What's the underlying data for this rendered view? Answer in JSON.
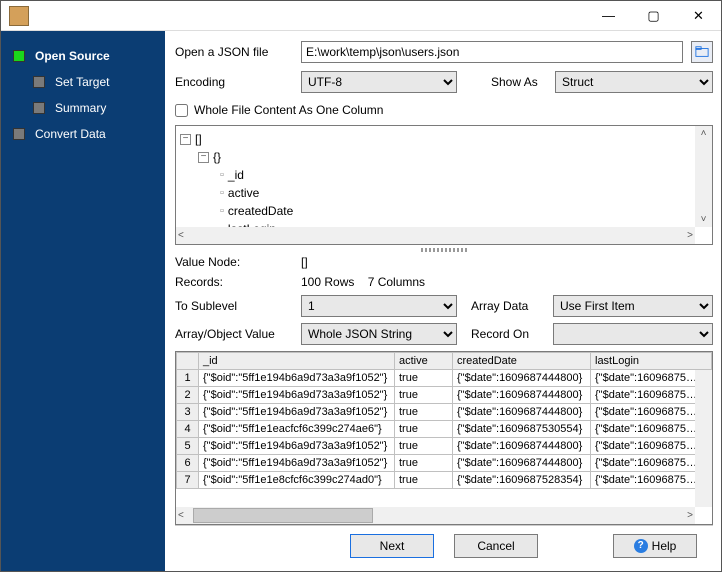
{
  "titlebar": {
    "minimize": "—",
    "maximize": "▢",
    "close": "✕"
  },
  "sidebar": {
    "steps": [
      {
        "label": "Open Source",
        "active": true
      },
      {
        "label": "Set Target",
        "active": false
      },
      {
        "label": "Summary",
        "active": false
      },
      {
        "label": "Convert Data",
        "active": false
      }
    ]
  },
  "form": {
    "open_label": "Open a JSON file",
    "file_path": "E:\\work\\temp\\json\\users.json",
    "encoding_label": "Encoding",
    "encoding_value": "UTF-8",
    "showas_label": "Show As",
    "showas_value": "Struct",
    "whole_file_label": "Whole File Content As One Column"
  },
  "tree": {
    "root": "[]",
    "child": "{}",
    "leaves": [
      "_id",
      "active",
      "createdDate",
      "lastLogin"
    ]
  },
  "mid": {
    "value_node_label": "Value Node:",
    "value_node": "[]",
    "records_label": "Records:",
    "records_value": "100 Rows    7 Columns",
    "to_sublevel_label": "To Sublevel",
    "to_sublevel_value": "1",
    "array_data_label": "Array Data",
    "array_data_value": "Use First Item",
    "array_obj_label": "Array/Object Value",
    "array_obj_value": "Whole JSON String",
    "record_on_label": "Record On",
    "record_on_value": ""
  },
  "grid": {
    "columns": [
      "_id",
      "active",
      "createdDate",
      "lastLogin"
    ],
    "rows": [
      {
        "n": "1",
        "_id": "{\"$oid\":\"5ff1e194b6a9d73a3a9f1052\"}",
        "active": "true",
        "createdDate": "{\"$date\":1609687444800}",
        "lastLogin": "{\"$date\":16096875…"
      },
      {
        "n": "2",
        "_id": "{\"$oid\":\"5ff1e194b6a9d73a3a9f1052\"}",
        "active": "true",
        "createdDate": "{\"$date\":1609687444800}",
        "lastLogin": "{\"$date\":16096875…"
      },
      {
        "n": "3",
        "_id": "{\"$oid\":\"5ff1e194b6a9d73a3a9f1052\"}",
        "active": "true",
        "createdDate": "{\"$date\":1609687444800}",
        "lastLogin": "{\"$date\":16096875…"
      },
      {
        "n": "4",
        "_id": "{\"$oid\":\"5ff1e1eacfcf6c399c274ae6\"}",
        "active": "true",
        "createdDate": "{\"$date\":1609687530554}",
        "lastLogin": "{\"$date\":16096875…"
      },
      {
        "n": "5",
        "_id": "{\"$oid\":\"5ff1e194b6a9d73a3a9f1052\"}",
        "active": "true",
        "createdDate": "{\"$date\":1609687444800}",
        "lastLogin": "{\"$date\":16096875…"
      },
      {
        "n": "6",
        "_id": "{\"$oid\":\"5ff1e194b6a9d73a3a9f1052\"}",
        "active": "true",
        "createdDate": "{\"$date\":1609687444800}",
        "lastLogin": "{\"$date\":16096875…"
      },
      {
        "n": "7",
        "_id": "{\"$oid\":\"5ff1e1e8cfcf6c399c274ad0\"}",
        "active": "true",
        "createdDate": "{\"$date\":1609687528354}",
        "lastLogin": "{\"$date\":16096875…"
      }
    ]
  },
  "footer": {
    "next": "Next",
    "cancel": "Cancel",
    "help": "Help"
  }
}
